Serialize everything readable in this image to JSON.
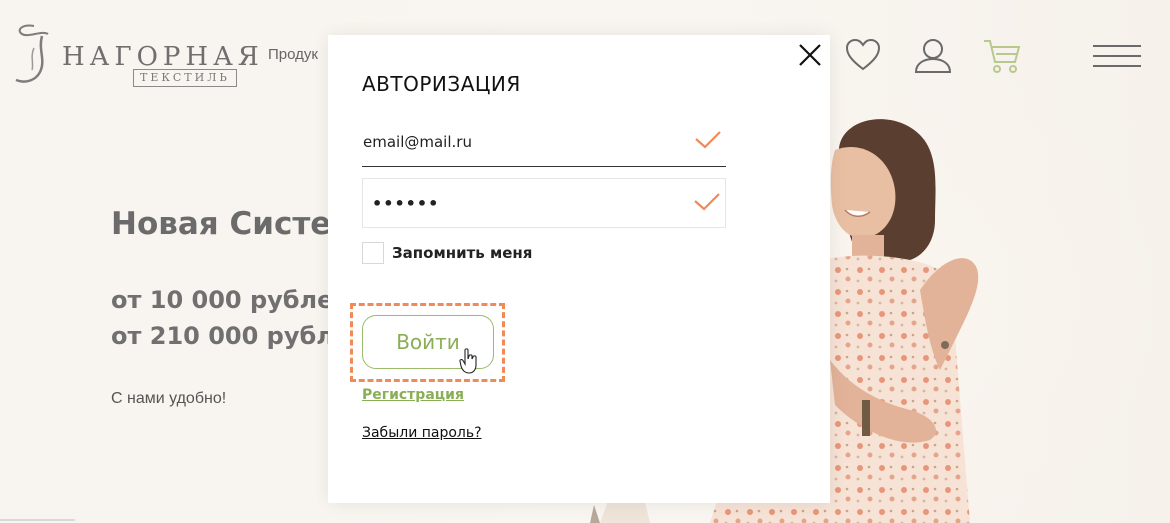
{
  "brand": {
    "title": "НАГОРНАЯ",
    "subtitle": "ТЕКСТИЛЬ"
  },
  "header": {
    "nav_label": "Продук",
    "icons": [
      "heart-icon",
      "user-icon",
      "cart-icon",
      "hamburger-menu-icon"
    ]
  },
  "hero": {
    "title": "Новая Систем",
    "price_1": "от 10 000 рубле",
    "price_2": "от 210 000 рубл",
    "note": "С нами удобно!"
  },
  "modal": {
    "title": "АВТОРИЗАЦИЯ",
    "email_value": "email@mail.ru",
    "password_value": "••••••",
    "remember_label": "Запомнить меня",
    "remember_checked": false,
    "login_label": "Войти",
    "register_label": "Регистрация",
    "forgot_label": "Забыли пароль?"
  },
  "colors": {
    "accent_green": "#8aae55",
    "check_orange": "#f28a58",
    "cart_green": "#b7c98d"
  }
}
